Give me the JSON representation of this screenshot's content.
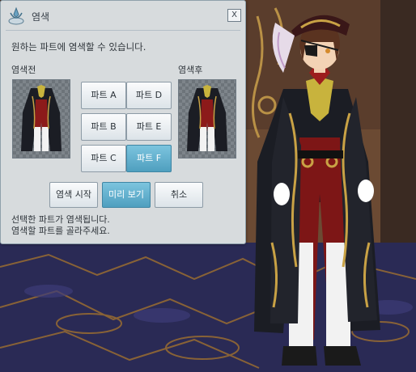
{
  "window": {
    "title": "염색",
    "close_label": "X",
    "instruction": "원하는 파트에 염색할 수 있습니다.",
    "before_label": "염색전",
    "after_label": "염색후"
  },
  "parts": {
    "a": "파트 A",
    "b": "파트 B",
    "c": "파트 C",
    "d": "파트 D",
    "e": "파트 E",
    "f": "파트 F",
    "selected": "파트 F"
  },
  "actions": {
    "start": "염색 시작",
    "preview": "미리 보기",
    "cancel": "취소"
  },
  "status": {
    "line1": "선택한 파트가 염색됩니다.",
    "line2": "염색할 파트를 골라주세요."
  },
  "colors": {
    "coat": "#1a1c22",
    "lining": "#8c1a1a",
    "trim": "#c8a040",
    "selected_button": "#5aaed0"
  }
}
